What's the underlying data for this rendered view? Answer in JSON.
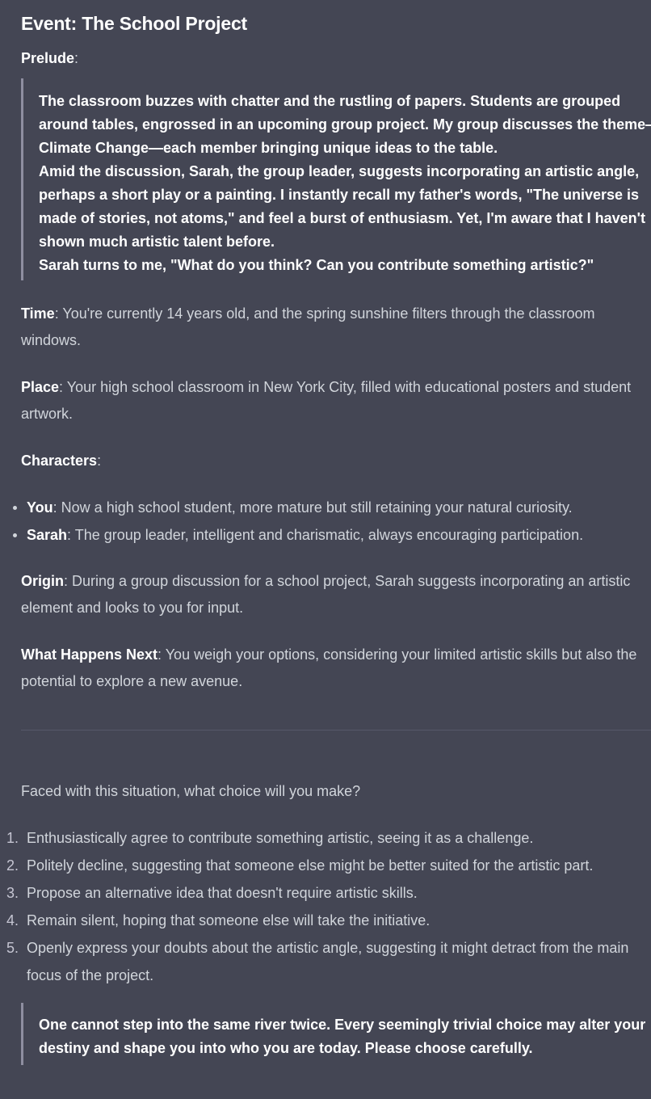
{
  "event": {
    "title": "Event: The School Project"
  },
  "prelude": {
    "label": "Prelude",
    "colon": ":",
    "paragraphs": [
      "The classroom buzzes with chatter and the rustling of papers. Students are grouped around tables, engrossed in an upcoming group project. My group discusses the theme—Climate Change—each member bringing unique ideas to the table.",
      "Amid the discussion, Sarah, the group leader, suggests incorporating an artistic angle, perhaps a short play or a painting. I instantly recall my father's words, \"The universe is made of stories, not atoms,\" and feel a burst of enthusiasm. Yet, I'm aware that I haven't shown much artistic talent before.",
      "Sarah turns to me, \"What do you think? Can you contribute something artistic?\""
    ]
  },
  "time": {
    "label": "Time",
    "text": ": You're currently 14 years old, and the spring sunshine filters through the classroom windows."
  },
  "place": {
    "label": "Place",
    "text": ": Your high school classroom in New York City, filled with educational posters and student artwork."
  },
  "characters": {
    "label": "Characters",
    "colon": ":",
    "items": [
      {
        "name": "You",
        "text": ": Now a high school student, more mature but still retaining your natural curiosity."
      },
      {
        "name": "Sarah",
        "text": ": The group leader, intelligent and charismatic, always encouraging participation."
      }
    ]
  },
  "origin": {
    "label": "Origin",
    "text": ": During a group discussion for a school project, Sarah suggests incorporating an artistic element and looks to you for input."
  },
  "next": {
    "label": "What Happens Next",
    "text": ": You weigh your options, considering your limited artistic skills but also the potential to explore a new avenue."
  },
  "question": "Faced with this situation, what choice will you make?",
  "choices": [
    {
      "num": "1.",
      "text": "Enthusiastically agree to contribute something artistic, seeing it as a challenge."
    },
    {
      "num": "2.",
      "text": "Politely decline, suggesting that someone else might be better suited for the artistic part."
    },
    {
      "num": "3.",
      "text": "Propose an alternative idea that doesn't require artistic skills."
    },
    {
      "num": "4.",
      "text": "Remain silent, hoping that someone else will take the initiative."
    },
    {
      "num": "5.",
      "text": "Openly express your doubts about the artistic angle, suggesting it might detract from the main focus of the project."
    }
  ],
  "closing_quote": "One cannot step into the same river twice. Every seemingly trivial choice may alter your destiny and shape you into who you are today. Please choose carefully.",
  "colors": {
    "background": "#444654",
    "text": "#d1d5db",
    "strong_text": "#ffffff",
    "quote_border": "#8e8ea0",
    "divider": "#565869"
  }
}
